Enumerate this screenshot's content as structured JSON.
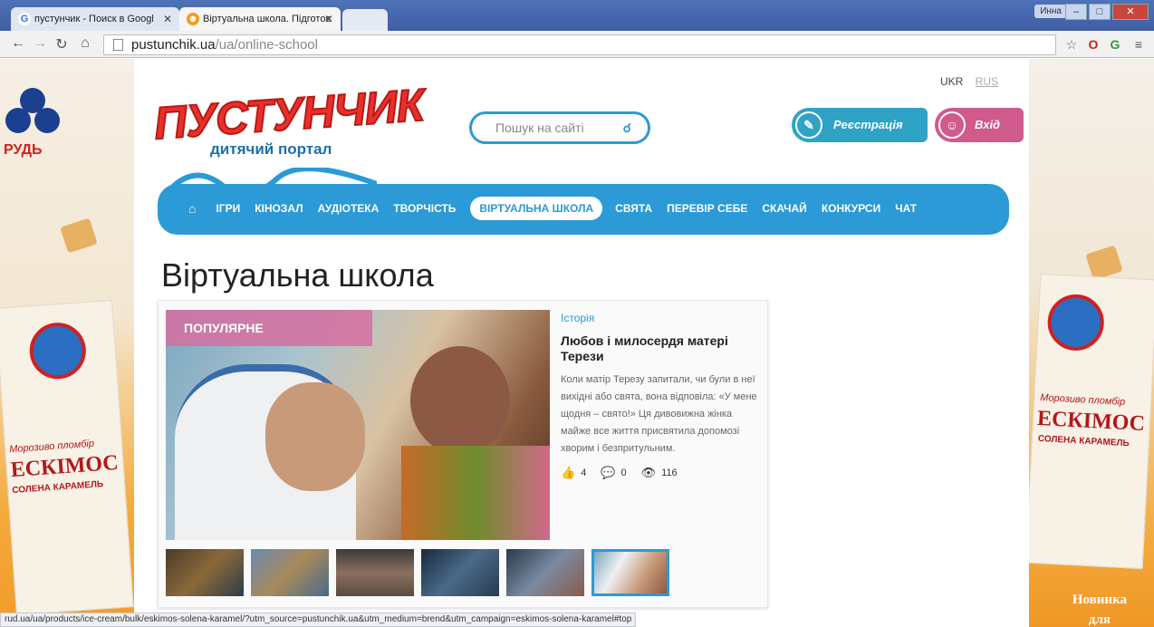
{
  "browser": {
    "tabs": [
      {
        "title": "пустунчик - Поиск в Googl",
        "icon": "google-g-icon"
      },
      {
        "title": "Віртуальна школа. Підготов",
        "icon": "site-favicon"
      }
    ],
    "user": "Инна",
    "url_domain": "pustunchik.ua",
    "url_path": "/ua/online-school",
    "status_url": "rud.ua/ua/products/ice-cream/bulk/eskimos-solena-karamel/?utm_source=pustunchik.ua&utm_medium=brend&utm_campaign=eskimos-solena-karamel#top"
  },
  "ad": {
    "brand": "РУДЬ",
    "product_left_1": "Морозиво пломбір",
    "product_left_2": "ЕСКІМОС",
    "product_left_3": "СОЛЕНА КАРАМЕЛЬ",
    "product_right_1": "Морозиво пломбір",
    "product_right_2": "ЕСКІМОС",
    "product_right_3": "СОЛЕНА КАРАМЕЛЬ",
    "novinka_1": "Новинка",
    "novinka_2": "для"
  },
  "site": {
    "lang_ukr": "UKR",
    "lang_rus": "RUS",
    "logo_text": "ПУСТУНЧИК",
    "logo_sub": "дитячий портал",
    "search_placeholder": "Пошук на сайті",
    "register_label": "Реєстрація",
    "login_label": "Вхід",
    "nav": [
      "ІГРИ",
      "КІНОЗАЛ",
      "АУДІОТЕКА",
      "ТВОРЧІСТЬ",
      "ВІРТУАЛЬНА ШКОЛА",
      "СВЯТА",
      "ПЕРЕВІР СЕБЕ",
      "СКАЧАЙ",
      "КОНКУРСИ",
      "ЧАТ"
    ],
    "page_title": "Віртуальна школа"
  },
  "featured": {
    "badge": "ПОПУЛЯРНЕ",
    "category": "Історія",
    "title": "Любов і милосердя матері Терези",
    "text": "Коли матір Терезу запитали, чи були в неї вихідні або свята, вона відповіла: «У мене щодня – свято!» Ця дивовижна жінка майже все життя присвятила допомозі хворим і безпритульним.",
    "likes": "4",
    "comments": "0",
    "views": "116"
  },
  "colors": {
    "accent": "#2b9ad6",
    "brand_red": "#e8302b",
    "pink": "#d05a8c",
    "teal": "#2fa3c6"
  }
}
